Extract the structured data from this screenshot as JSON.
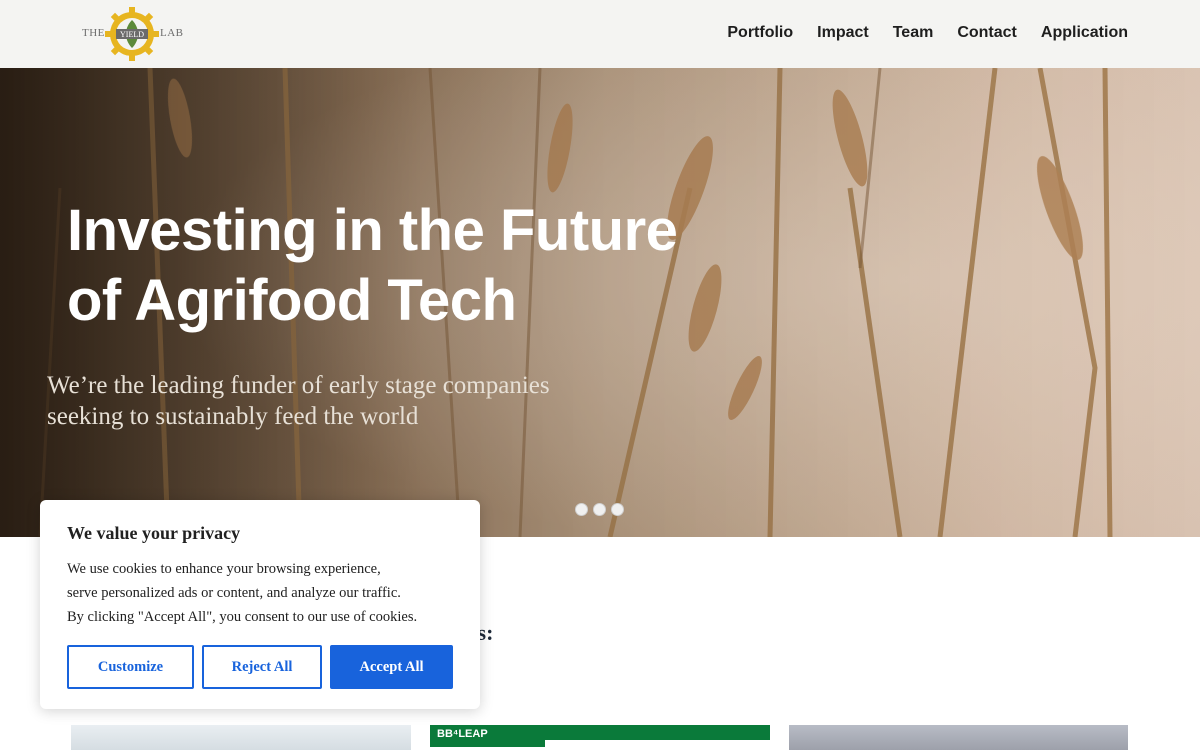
{
  "logo": {
    "left_word": "THE",
    "center_word": "YIELD",
    "right_word": "LAB",
    "gear_color": "#e7b520"
  },
  "nav": {
    "items": [
      "Portfolio",
      "Impact",
      "Team",
      "Contact",
      "Application"
    ]
  },
  "hero": {
    "title_line1": "Investing in the Future",
    "title_line2": "of Agrifood Tech",
    "subtitle_line1": "We’re the leading funder of early stage companies",
    "subtitle_line2": "seeking to sustainably feed the world",
    "slides": {
      "count": 3
    }
  },
  "section": {
    "heading_fragment": "nts:"
  },
  "cards": {
    "card2_tag": "BB⁴LEAP"
  },
  "cookie": {
    "title": "We value your privacy",
    "line1": "We use cookies to enhance your browsing experience,",
    "line2": "serve personalized ads or content, and analyze our traffic.",
    "line3": "By clicking \"Accept All\", you consent to our use of cookies.",
    "customize_label": "Customize",
    "reject_label": "Reject All",
    "accept_label": "Accept All",
    "accent_color": "#1863dc"
  }
}
